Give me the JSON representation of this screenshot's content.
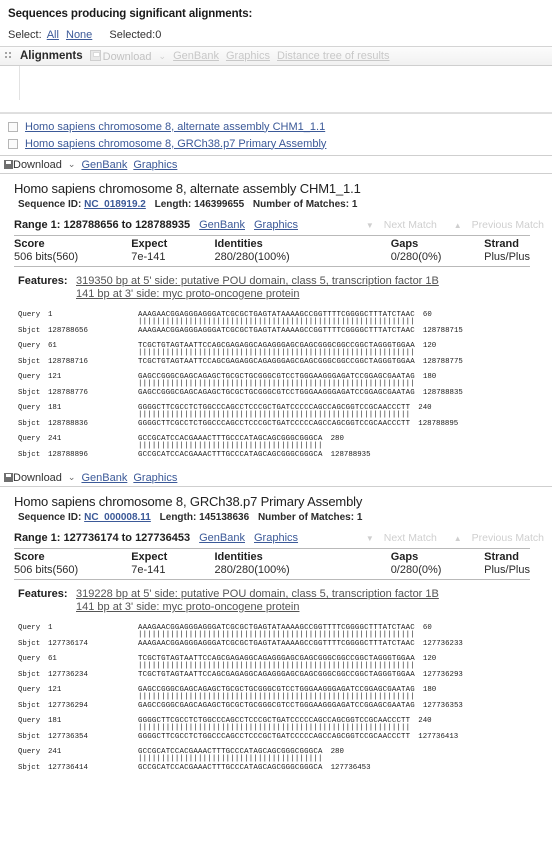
{
  "header": {
    "section_title": "Sequences producing significant alignments:",
    "select_label": "Select:",
    "select_all": "All",
    "select_none": "None",
    "selected_count": "Selected:0"
  },
  "toolbar": {
    "tab_label": "Alignments",
    "download": "Download",
    "caret": "⌄",
    "genbank": "GenBank",
    "graphics": "Graphics",
    "distance_tree": "Distance tree of results"
  },
  "hits": [
    {
      "title": "Homo sapiens chromosome 8, alternate assembly CHM1_1.1"
    },
    {
      "title": "Homo sapiens chromosome 8, GRCh38.p7 Primary Assembly"
    }
  ],
  "alignments": [
    {
      "bar": {
        "download": "Download",
        "caret": "⌄",
        "genbank": "GenBank",
        "graphics": "Graphics"
      },
      "title": "Homo sapiens chromosome 8, alternate assembly CHM1_1.1",
      "meta": {
        "seqid_label": "Sequence ID:",
        "seqid": "NC_018919.2",
        "length_label": "Length:",
        "length": "146399655",
        "matches_label": "Number of Matches:",
        "matches": "1"
      },
      "range": {
        "label": "Range 1: 128788656 to 128788935",
        "genbank": "GenBank",
        "graphics": "Graphics",
        "next_match": "Next Match",
        "previous_match": "Previous Match"
      },
      "stats": {
        "headers": [
          "Score",
          "Expect",
          "Identities",
          "Gaps",
          "Strand"
        ],
        "values": [
          "506 bits(560)",
          "7e-141",
          "280/280(100%)",
          "0/280(0%)",
          "Plus/Plus"
        ]
      },
      "features": {
        "label": "Features:",
        "items": [
          "319350 bp at 5' side: putative POU domain, class 5, transcription factor 1B",
          "141 bp at 3' side: myc proto-oncogene protein"
        ]
      },
      "query_label": "Query",
      "sbjct_label": "Sbjct",
      "blocks": [
        {
          "query_start": "1",
          "query_end": "60",
          "sbjct_start": "128788656",
          "sbjct_end": "128788715",
          "query_seq": "AAAGAACGGAGGGAGGGATCGCGCTGAGTATAAAAGCCGGTTTTCGGGGCTTTATCTAAC",
          "sbjct_seq": "AAAGAACGGAGGGAGGGATCGCGCTGAGTATAAAAGCCGGTTTTCGGGGCTTTATCTAAC",
          "match_bars": "||||||||||||||||||||||||||||||||||||||||||||||||||||||||||||"
        },
        {
          "query_start": "61",
          "query_end": "120",
          "sbjct_start": "128788716",
          "sbjct_end": "128788775",
          "query_seq": "TCGCTGTAGTAATTCCAGCGAGAGGCAGAGGGAGCGAGCGGGCGGCCGGCTAGGGTGGAA",
          "sbjct_seq": "TCGCTGTAGTAATTCCAGCGAGAGGCAGAGGGAGCGAGCGGGCGGCCGGCTAGGGTGGAA",
          "match_bars": "||||||||||||||||||||||||||||||||||||||||||||||||||||||||||||"
        },
        {
          "query_start": "121",
          "query_end": "180",
          "sbjct_start": "128788776",
          "sbjct_end": "128788835",
          "query_seq": "GAGCCGGGCGAGCAGAGCTGCGCTGCGGGCGTCCTGGGAAGGGAGATCCGGAGCGAATAG",
          "sbjct_seq": "GAGCCGGGCGAGCAGAGCTGCGCTGCGGGCGTCCTGGGAAGGGAGATCCGGAGCGAATAG",
          "match_bars": "||||||||||||||||||||||||||||||||||||||||||||||||||||||||||||"
        },
        {
          "query_start": "181",
          "query_end": "240",
          "sbjct_start": "128788836",
          "sbjct_end": "128788895",
          "query_seq": "GGGGCTTCGCCTCTGGCCCAGCCTCCCGCTGATCCCCCAGCCAGCGGTCCGCAACCCTT",
          "sbjct_seq": "GGGGCTTCGCCTCTGGCCCAGCCTCCCGCTGATCCCCCAGCCAGCGGTCCGCAACCCTT",
          "match_bars": "|||||||||||||||||||||||||||||||||||||||||||||||||||||||||||"
        },
        {
          "query_start": "241",
          "query_end": "280",
          "sbjct_start": "128788896",
          "sbjct_end": "128788935",
          "query_seq": "GCCGCATCCACGAAACTTTGCCCATAGCAGCGGGCGGGCA",
          "sbjct_seq": "GCCGCATCCACGAAACTTTGCCCATAGCAGCGGGCGGGCA",
          "match_bars": "||||||||||||||||||||||||||||||||||||||||"
        }
      ]
    },
    {
      "bar": {
        "download": "Download",
        "caret": "⌄",
        "genbank": "GenBank",
        "graphics": "Graphics"
      },
      "title": "Homo sapiens chromosome 8, GRCh38.p7 Primary Assembly",
      "meta": {
        "seqid_label": "Sequence ID:",
        "seqid": "NC_000008.11",
        "length_label": "Length:",
        "length": "145138636",
        "matches_label": "Number of Matches:",
        "matches": "1"
      },
      "range": {
        "label": "Range 1: 127736174 to 127736453",
        "genbank": "GenBank",
        "graphics": "Graphics",
        "next_match": "Next Match",
        "previous_match": "Previous Match"
      },
      "stats": {
        "headers": [
          "Score",
          "Expect",
          "Identities",
          "Gaps",
          "Strand"
        ],
        "values": [
          "506 bits(560)",
          "7e-141",
          "280/280(100%)",
          "0/280(0%)",
          "Plus/Plus"
        ]
      },
      "features": {
        "label": "Features:",
        "items": [
          "319228 bp at 5' side: putative POU domain, class 5, transcription factor 1B",
          "141 bp at 3' side: myc proto-oncogene protein"
        ]
      },
      "query_label": "Query",
      "sbjct_label": "Sbjct",
      "blocks": [
        {
          "query_start": "1",
          "query_end": "60",
          "sbjct_start": "127736174",
          "sbjct_end": "127736233",
          "query_seq": "AAAGAACGGAGGGAGGGATCGCGCTGAGTATAAAAGCCGGTTTTCGGGGCTTTATCTAAC",
          "sbjct_seq": "AAAGAACGGAGGGAGGGATCGCGCTGAGTATAAAAGCCGGTTTTCGGGGCTTTATCTAAC",
          "match_bars": "||||||||||||||||||||||||||||||||||||||||||||||||||||||||||||"
        },
        {
          "query_start": "61",
          "query_end": "120",
          "sbjct_start": "127736234",
          "sbjct_end": "127736293",
          "query_seq": "TCGCTGTAGTAATTCCAGCGAGAGGCAGAGGGAGCGAGCGGGCGGCCGGCTAGGGTGGAA",
          "sbjct_seq": "TCGCTGTAGTAATTCCAGCGAGAGGCAGAGGGAGCGAGCGGGCGGCCGGCTAGGGTGGAA",
          "match_bars": "||||||||||||||||||||||||||||||||||||||||||||||||||||||||||||"
        },
        {
          "query_start": "121",
          "query_end": "180",
          "sbjct_start": "127736294",
          "sbjct_end": "127736353",
          "query_seq": "GAGCCGGGCGAGCAGAGCTGCGCTGCGGGCGTCCTGGGAAGGGAGATCCGGAGCGAATAG",
          "sbjct_seq": "GAGCCGGGCGAGCAGAGCTGCGCTGCGGGCGTCCTGGGAAGGGAGATCCGGAGCGAATAG",
          "match_bars": "||||||||||||||||||||||||||||||||||||||||||||||||||||||||||||"
        },
        {
          "query_start": "181",
          "query_end": "240",
          "sbjct_start": "127736354",
          "sbjct_end": "127736413",
          "query_seq": "GGGGCTTCGCCTCTGGCCCAGCCTCCCGCTGATCCCCCAGCCAGCGGTCCGCAACCCTT",
          "sbjct_seq": "GGGGCTTCGCCTCTGGCCCAGCCTCCCGCTGATCCCCCAGCCAGCGGTCCGCAACCCTT",
          "match_bars": "|||||||||||||||||||||||||||||||||||||||||||||||||||||||||||"
        },
        {
          "query_start": "241",
          "query_end": "280",
          "sbjct_start": "127736414",
          "sbjct_end": "127736453",
          "query_seq": "GCCGCATCCACGAAACTTTGCCCATAGCAGCGGGCGGGCA",
          "sbjct_seq": "GCCGCATCCACGAAACTTTGCCCATAGCAGCGGGCGGGCA",
          "match_bars": "||||||||||||||||||||||||||||||||||||||||"
        }
      ]
    }
  ]
}
